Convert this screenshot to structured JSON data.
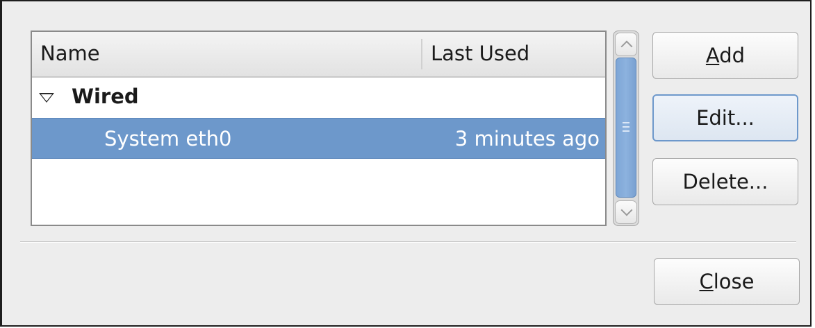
{
  "tree": {
    "columns": {
      "name": "Name",
      "last_used": "Last Used"
    },
    "group": {
      "label": "Wired",
      "expanded": true
    },
    "connections": [
      {
        "name": "System eth0",
        "last_used": "3 minutes ago",
        "selected": true
      }
    ]
  },
  "buttons": {
    "add": {
      "mnemonic": "A",
      "rest": "dd"
    },
    "edit": {
      "label": "Edit..."
    },
    "delete": {
      "label": "Delete..."
    },
    "close": {
      "mnemonic": "C",
      "rest": "lose"
    }
  },
  "icons": {
    "expander": "triangle-down-icon",
    "scroll_up": "chevron-up-icon",
    "scroll_down": "chevron-down-icon"
  },
  "colors": {
    "selection": "#6d98cb",
    "dialog_bg": "#ededed",
    "focus_border": "#6d98cb"
  }
}
